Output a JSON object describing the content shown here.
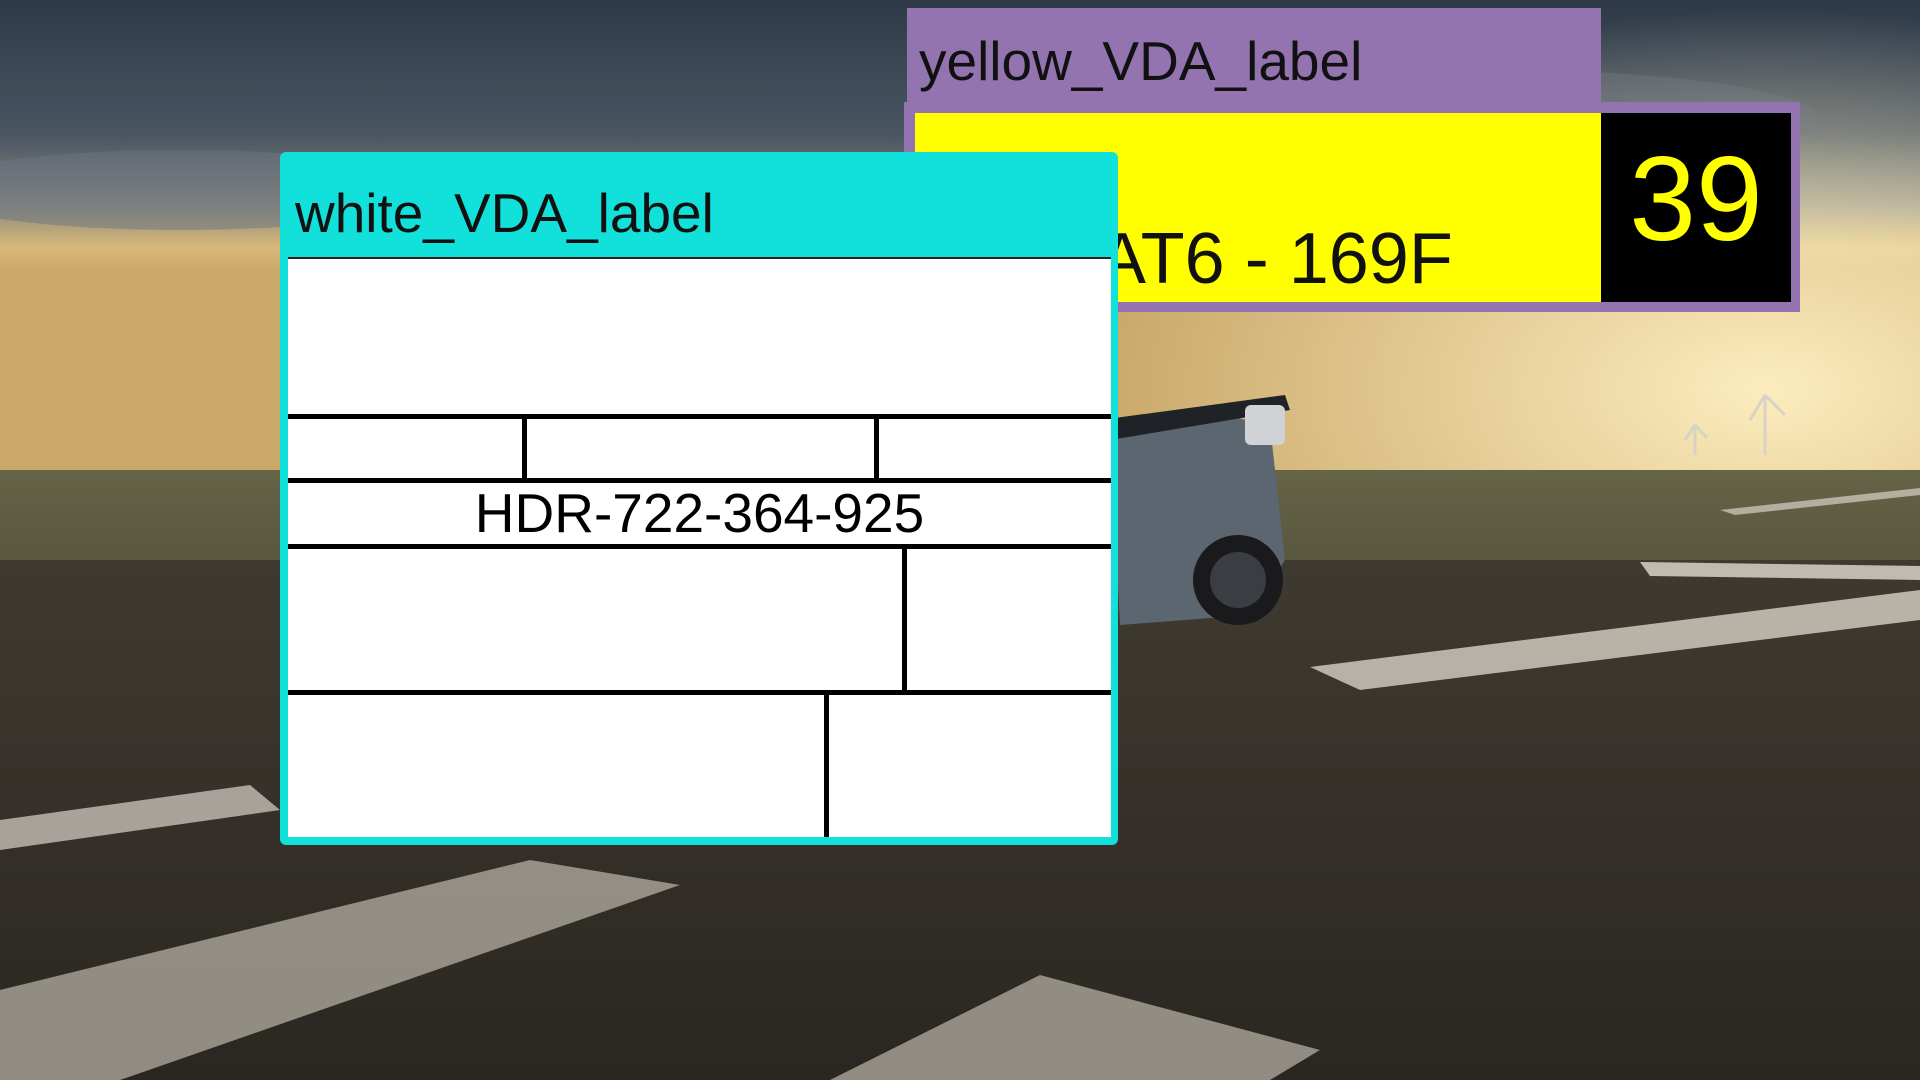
{
  "scene": {
    "description_icon": "runway-car-photo",
    "sky_color": "#5b6470",
    "horizon_glow": "#e8b96a",
    "ground_color": "#3a342d"
  },
  "yellow_label": {
    "tag": "yellow_VDA_label",
    "code": "AT6 - 169F",
    "number": "39",
    "tag_color": "#9374b0",
    "panel_color": "#ffff00"
  },
  "white_label": {
    "tag": "white_VDA_label",
    "id": "HDR-722-364-925",
    "tag_color": "#12e0da"
  }
}
